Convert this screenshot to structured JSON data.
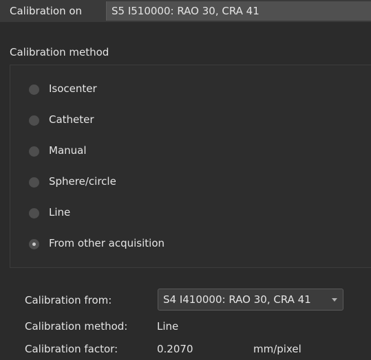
{
  "header": {
    "calibration_on_label": "Calibration on",
    "calibration_on_value": "S5 I510000: RAO 30, CRA 41"
  },
  "method_group": {
    "title": "Calibration method",
    "options": [
      {
        "label": "Isocenter",
        "checked": false
      },
      {
        "label": "Catheter",
        "checked": false
      },
      {
        "label": "Manual",
        "checked": false
      },
      {
        "label": "Sphere/circle",
        "checked": false
      },
      {
        "label": "Line",
        "checked": false
      },
      {
        "label": "From other acquisition",
        "checked": true
      }
    ]
  },
  "source": {
    "calibration_from_label": "Calibration from:",
    "calibration_from_value": "S4 I410000: RAO 30, CRA 41",
    "calibration_method_label": "Calibration method:",
    "calibration_method_value": "Line",
    "calibration_factor_label": "Calibration factor:",
    "calibration_factor_value": "0.2070",
    "calibration_factor_unit": "mm/pixel"
  }
}
